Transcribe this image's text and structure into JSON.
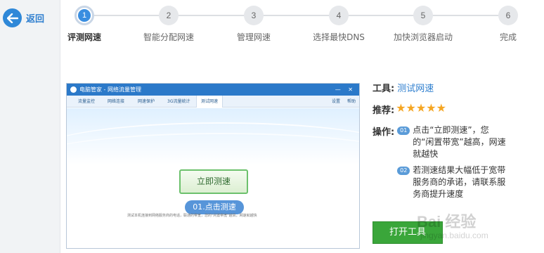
{
  "nav": {
    "back_label": "返回"
  },
  "steps": [
    {
      "num": "1",
      "label": "评测网速",
      "active": true
    },
    {
      "num": "2",
      "label": "智能分配网速",
      "active": false
    },
    {
      "num": "3",
      "label": "管理网速",
      "active": false
    },
    {
      "num": "4",
      "label": "选择最快DNS",
      "active": false
    },
    {
      "num": "5",
      "label": "加快浏览器启动",
      "active": false
    },
    {
      "num": "6",
      "label": "完成",
      "active": false
    }
  ],
  "preview": {
    "window_title": "电脑管家 - 网络流量管理",
    "window_controls": "— ✕",
    "tabs": [
      "流量监控",
      "网络连接",
      "网速保护",
      "3G流量统计",
      "测试网速"
    ],
    "right_links": [
      "设置",
      "帮助"
    ],
    "test_button": "立即测速",
    "callout": "01.点击测速",
    "description": "测试本机连接到网络服务商的电话，联通的带宽，您的\"闲置带宽\"越高，网速就越快"
  },
  "info": {
    "tool_label": "工具:",
    "tool_value": "测试网速",
    "rating_label": "推荐:",
    "rating_stars": 5,
    "ops_label": "操作:",
    "ops": [
      {
        "num": "01",
        "text": "点击“立即测速”，您的“闲置带宽”越高，网速就越快"
      },
      {
        "num": "02",
        "text": "若测速结果大幅低于宽带服务商的承诺，请联系服务商提升速度"
      }
    ],
    "open_button": "打开工具"
  },
  "watermark": {
    "text": "Bai 经验",
    "sub": "jingyan.baidu.com"
  }
}
